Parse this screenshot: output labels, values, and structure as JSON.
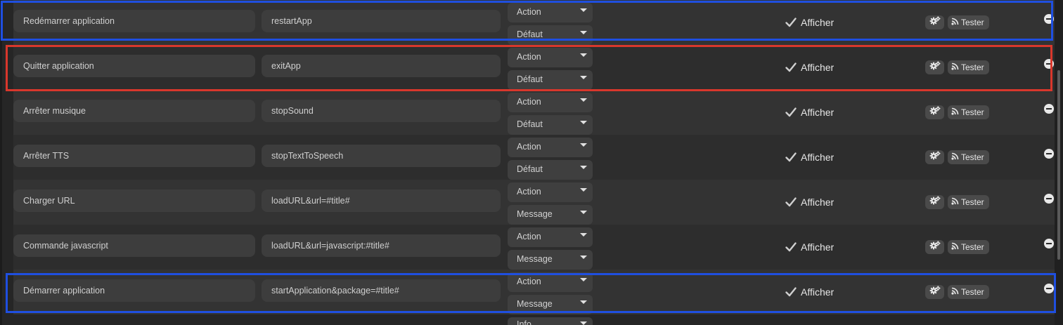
{
  "rows": [
    {
      "name": "Redémarrer application",
      "command": "restartApp",
      "type": "Action",
      "mode": "Défaut",
      "show_label": "Afficher",
      "test_label": "Tester"
    },
    {
      "name": "Quitter application",
      "command": "exitApp",
      "type": "Action",
      "mode": "Défaut",
      "show_label": "Afficher",
      "test_label": "Tester"
    },
    {
      "name": "Arrêter musique",
      "command": "stopSound",
      "type": "Action",
      "mode": "Défaut",
      "show_label": "Afficher",
      "test_label": "Tester"
    },
    {
      "name": "Arrêter TTS",
      "command": "stopTextToSpeech",
      "type": "Action",
      "mode": "Défaut",
      "show_label": "Afficher",
      "test_label": "Tester"
    },
    {
      "name": "Charger URL",
      "command": "loadURL&url=#title#",
      "type": "Action",
      "mode": "Message",
      "show_label": "Afficher",
      "test_label": "Tester"
    },
    {
      "name": "Commande javascript",
      "command": "loadURL&url=javascript:#title#",
      "type": "Action",
      "mode": "Message",
      "show_label": "Afficher",
      "test_label": "Tester"
    },
    {
      "name": "Démarrer application",
      "command": "startApplication&package=#title#",
      "type": "Action",
      "mode": "Message",
      "show_label": "Afficher",
      "test_label": "Tester"
    }
  ],
  "partial_row": {
    "type": "Info"
  },
  "colors": {
    "highlight_blue": "#1f4fe0",
    "highlight_red": "#d9372c",
    "background": "#262626"
  },
  "icons": {
    "show_checkbox": "check-icon",
    "config": "gears-icon",
    "test": "rss-icon",
    "remove": "minus-circle-icon"
  }
}
